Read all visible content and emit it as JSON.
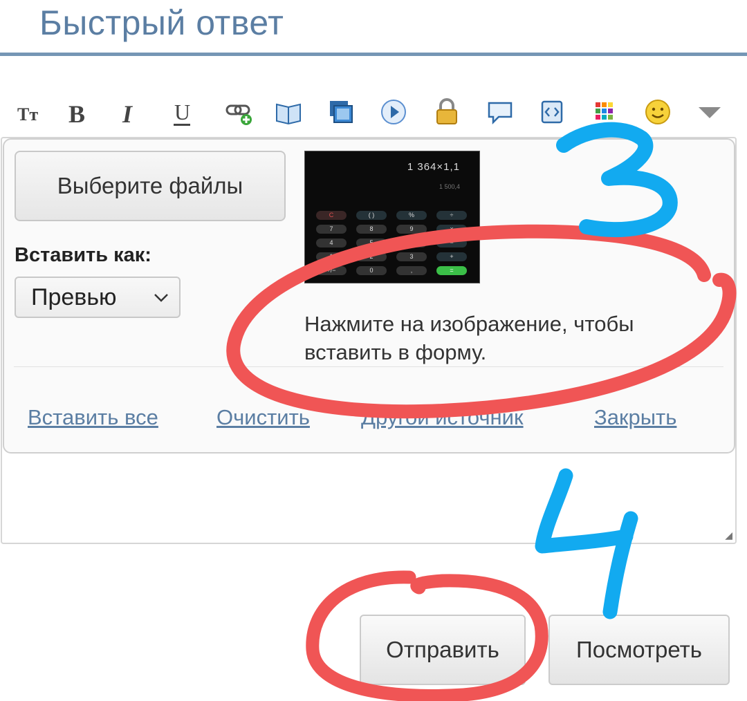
{
  "page": {
    "title": "Быстрый ответ"
  },
  "toolbar": {
    "items": [
      {
        "name": "font-size-icon",
        "glyph": "Tт"
      },
      {
        "name": "bold-icon",
        "glyph": "B"
      },
      {
        "name": "italic-icon",
        "glyph": "I"
      },
      {
        "name": "underline-icon",
        "glyph": "U"
      },
      {
        "name": "insert-link-icon"
      },
      {
        "name": "book-icon"
      },
      {
        "name": "insert-image-icon"
      },
      {
        "name": "media-play-icon"
      },
      {
        "name": "lock-icon"
      },
      {
        "name": "speech-bubble-icon"
      },
      {
        "name": "code-icon"
      },
      {
        "name": "color-grid-icon"
      },
      {
        "name": "smiley-icon"
      },
      {
        "name": "more-dropdown-icon"
      }
    ]
  },
  "upload_panel": {
    "choose_files_label": "Выберите файлы",
    "insert_as_label": "Вставить как:",
    "insert_as_value": "Превью",
    "hint": "Нажмите на изображение, чтобы вставить в форму.",
    "thumbnail": {
      "display": "1 364×1,1",
      "sub": "1 500,4",
      "key_rows": [
        [
          "C",
          "( )",
          "%",
          "÷"
        ],
        [
          "7",
          "8",
          "9",
          "×"
        ],
        [
          "4",
          "5",
          "6",
          "−"
        ],
        [
          "1",
          "2",
          "3",
          "+"
        ],
        [
          "+/−",
          "0",
          ",",
          "="
        ]
      ]
    },
    "links": {
      "insert_all": "Вставить все",
      "clear": "Очистить",
      "other_source": "Другой источник",
      "close": "Закрыть"
    }
  },
  "actions": {
    "submit_label": "Отправить",
    "preview_label": "Посмотреть"
  },
  "annotations": {
    "step_three": "3",
    "step_four": "4",
    "red": "#f05555",
    "blue": "#12aaf0"
  }
}
